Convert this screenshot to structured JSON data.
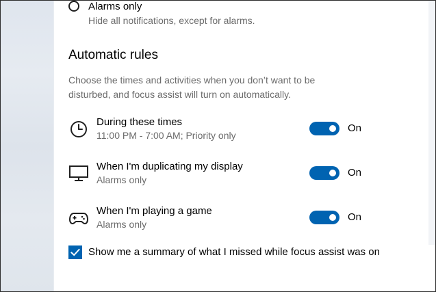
{
  "alarms_only": {
    "label": "Alarms only",
    "description": "Hide all notifications, except for alarms.",
    "selected": false
  },
  "automatic_rules": {
    "title": "Automatic rules",
    "description": "Choose the times and activities when you don’t want to be disturbed, and focus assist will turn on automatically.",
    "rules": [
      {
        "icon": "clock-icon",
        "title": "During these times",
        "subtitle": "11:00 PM - 7:00 AM; Priority only",
        "toggle_state": "On"
      },
      {
        "icon": "monitor-icon",
        "title": "When I'm duplicating my display",
        "subtitle": "Alarms only",
        "toggle_state": "On"
      },
      {
        "icon": "gamepad-icon",
        "title": "When I'm playing a game",
        "subtitle": "Alarms only",
        "toggle_state": "On"
      }
    ]
  },
  "summary_checkbox": {
    "label": "Show me a summary of what I missed while focus assist was on",
    "checked": true
  },
  "colors": {
    "accent": "#0063b1",
    "secondary_text": "#6b6b6b"
  }
}
